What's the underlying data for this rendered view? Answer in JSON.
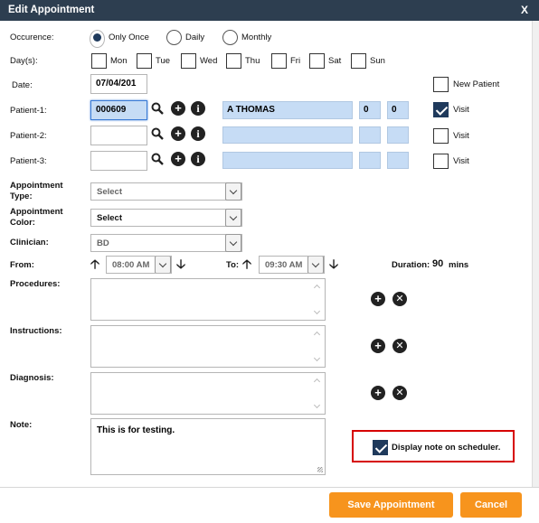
{
  "window": {
    "title": "Edit Appointment",
    "close_label": "X"
  },
  "occurrence": {
    "label": "Occurence:",
    "options": [
      "Only Once",
      "Daily",
      "Monthly"
    ],
    "selected": "Only Once"
  },
  "days": {
    "label": "Day(s):",
    "items": [
      "Mon",
      "Tue",
      "Wed",
      "Thu",
      "Fri",
      "Sat",
      "Sun"
    ]
  },
  "date": {
    "label": "Date:",
    "value": "07/04/201"
  },
  "new_patient": {
    "label": "New Patient",
    "checked": false
  },
  "patients": [
    {
      "label": "Patient-1:",
      "id": "000609",
      "name": "A THOMAS",
      "v1": "0",
      "v2": "0",
      "visit_label": "Visit",
      "visit_checked": true
    },
    {
      "label": "Patient-2:",
      "id": "",
      "name": "",
      "v1": "",
      "v2": "",
      "visit_label": "Visit",
      "visit_checked": false
    },
    {
      "label": "Patient-3:",
      "id": "",
      "name": "",
      "v1": "",
      "v2": "",
      "visit_label": "Visit",
      "visit_checked": false
    }
  ],
  "appointment_type": {
    "label_line1": "Appointment",
    "label_line2": "Type:",
    "value": "Select"
  },
  "appointment_color": {
    "label_line1": "Appointment",
    "label_line2": "Color:",
    "value": "Select"
  },
  "clinician": {
    "label": "Clinician:",
    "value": "BD"
  },
  "from": {
    "label": "From:",
    "value": "08:00 AM"
  },
  "to": {
    "label": "To:",
    "value": "09:30 AM"
  },
  "duration": {
    "label": "Duration:",
    "value": "90",
    "unit": "mins"
  },
  "procedures": {
    "label": "Procedures:",
    "value": ""
  },
  "instructions": {
    "label": "Instructions:",
    "value": ""
  },
  "diagnosis": {
    "label": "Diagnosis:",
    "value": ""
  },
  "note": {
    "label": "Note:",
    "value": "This is for testing."
  },
  "display_note": {
    "label": "Display note on scheduler.",
    "checked": true
  },
  "buttons": {
    "save": "Save Appointment",
    "cancel": "Cancel"
  },
  "colors": {
    "titlebar": "#2d3e50",
    "accent": "#f7941d",
    "highlight": "#d60000",
    "check": "#1f3a5c"
  }
}
